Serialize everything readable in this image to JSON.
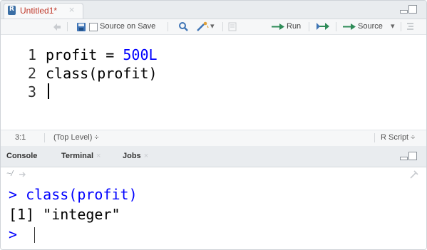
{
  "editor": {
    "tab_title": "Untitled1*",
    "tab_close": "×",
    "toolbar": {
      "source_on_save": "Source on Save",
      "run_label": "Run",
      "source_label": "Source",
      "dropdown_caret": "▾"
    },
    "lines": [
      {
        "number": "1",
        "code_prefix": "profit = ",
        "code_number": "500L"
      },
      {
        "number": "2",
        "code_prefix": "class(profit)",
        "code_number": ""
      },
      {
        "number": "3",
        "code_prefix": "",
        "code_number": ""
      }
    ],
    "status": {
      "position": "3:1",
      "scope": "(Top Level) ÷",
      "file_type": "R Script ÷"
    }
  },
  "console": {
    "tabs": [
      {
        "label": "Console",
        "close": ""
      },
      {
        "label": "Terminal",
        "close": "×"
      },
      {
        "label": "Jobs",
        "close": "×"
      }
    ],
    "path": "~/",
    "lines": [
      {
        "text": "> class(profit)"
      },
      {
        "text": "[1] \"integer\""
      },
      {
        "text": ">"
      }
    ]
  }
}
